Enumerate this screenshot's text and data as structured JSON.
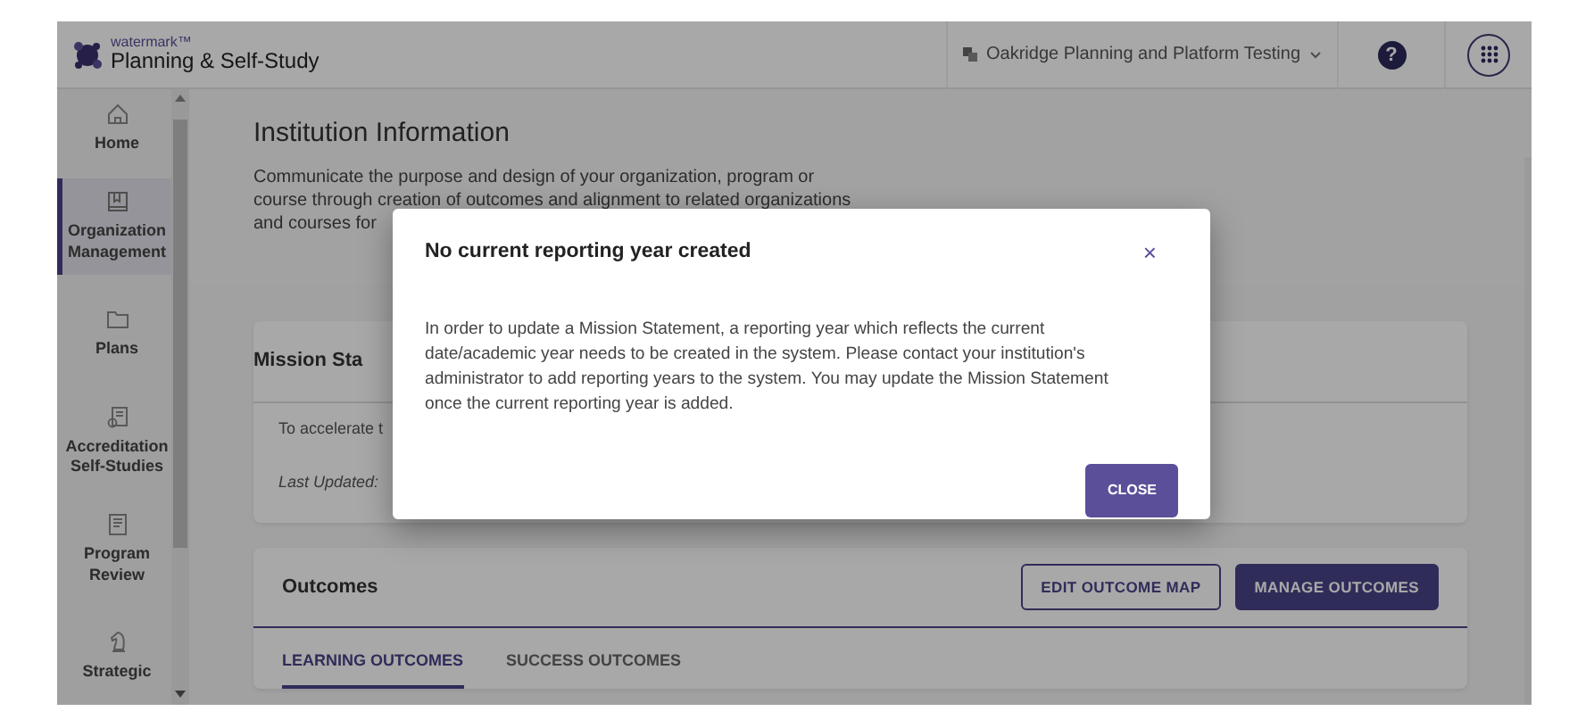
{
  "header": {
    "brand_small": "watermark™",
    "brand": "Planning & Self-Study",
    "org_selector": "Oakridge Planning and Platform Testing",
    "help": "?"
  },
  "sidebar": {
    "items": [
      {
        "label": "Home",
        "selected": false
      },
      {
        "label": "Organization Management",
        "selected": true
      },
      {
        "label": "Plans",
        "selected": false
      },
      {
        "label": "Accreditation Self-Studies",
        "selected": false
      },
      {
        "label": "Program Review",
        "selected": false
      },
      {
        "label": "Strategic",
        "selected": false
      }
    ]
  },
  "page": {
    "title": "Institution Information",
    "description": [
      "Communicate the purpose and design of your organization, program or",
      "course through creation of outcomes and alignment to related organizations",
      "and courses for"
    ]
  },
  "mission_card": {
    "title": "Mission Sta",
    "text": "To accelerate t",
    "last_updated": "Last Updated:"
  },
  "outcomes_card": {
    "title": "Outcomes",
    "buttons": [
      {
        "label": "EDIT OUTCOME MAP",
        "kind": "outline"
      },
      {
        "label": "MANAGE OUTCOMES",
        "kind": "solid"
      }
    ],
    "tabs": [
      {
        "label": "LEARNING OUTCOMES",
        "selected": true
      },
      {
        "label": "SUCCESS OUTCOMES",
        "selected": false
      }
    ]
  },
  "modal": {
    "title": "No current reporting year created",
    "close": "×",
    "body": "In order to update a Mission Statement, a reporting year which reflects the current date/academic year needs to be created in the system. Please contact your institution's administrator to add reporting years to the system. You may update the Mission Statement once the current reporting year is added.",
    "button": "CLOSE"
  }
}
